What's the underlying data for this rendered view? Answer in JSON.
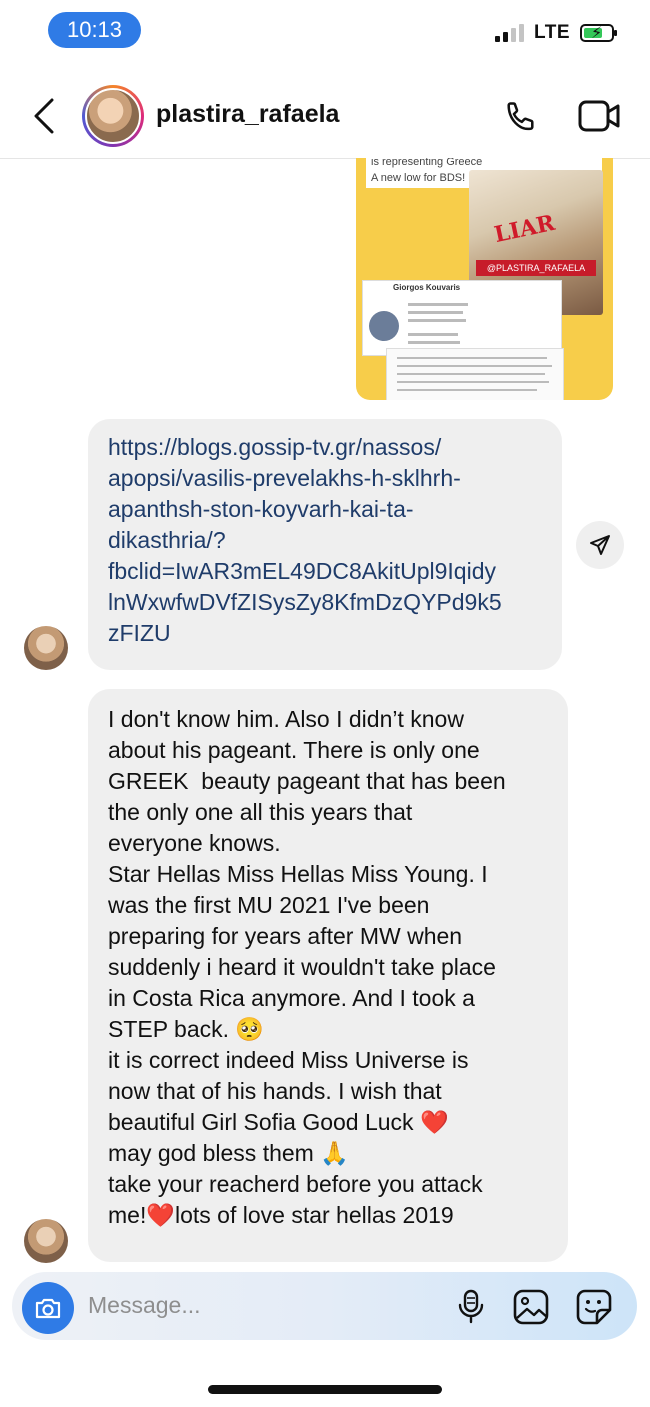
{
  "status_bar": {
    "time": "10:13",
    "network": "LTE"
  },
  "header": {
    "username": "plastira_rafaela"
  },
  "shared_image": {
    "caption_line1": "is representing Greece",
    "caption_line2": "A new low for BDS!",
    "overlay_word": "LIAR",
    "tag": "@PLASTIRA_RAFAELA",
    "card_name": "Giorgos Kouvaris"
  },
  "link_message": {
    "text": "https://blogs.gossip-tv.gr/nassos/\napopsi/vasilis-prevelakhs-h-sklhrh-\napanthsh-ston-koyvarh-kai-ta-\ndikasthria/?\nfbclid=IwAR3mEL49DC8AkitUpl9Iqidy\nlnWxwfwDVfZISysZy8KfmDzQYPd9k5\nzFIZU"
  },
  "text_message": {
    "text": "I don't know him. Also I didn’t know\nabout his pageant. There is only one\nGREEK  beauty pageant that has been\nthe only one all this years that\neveryone knows.\nStar Hellas Miss Hellas Miss Young. I\nwas the first MU 2021 I've been\npreparing for years after MW when\nsuddenly i heard it wouldn't take place\nin Costa Rica anymore. And I took a\nSTEP back. 🥺\nit is correct indeed Miss Universe is\nnow that of his hands. I wish that\nbeautiful Girl Sofia Good Luck ❤️\nmay god bless them 🙏\ntake your reacherd before you attack\nme!❤️lots of love star hellas 2019"
  },
  "composer": {
    "placeholder": "Message..."
  },
  "colors": {
    "accent": "#2f7be6",
    "link": "#1f3c6a",
    "bubble": "#efefef"
  },
  "icons": [
    "back-arrow-icon",
    "phone-icon",
    "video-icon",
    "share-icon",
    "camera-icon",
    "microphone-icon",
    "gallery-icon",
    "sticker-icon"
  ]
}
